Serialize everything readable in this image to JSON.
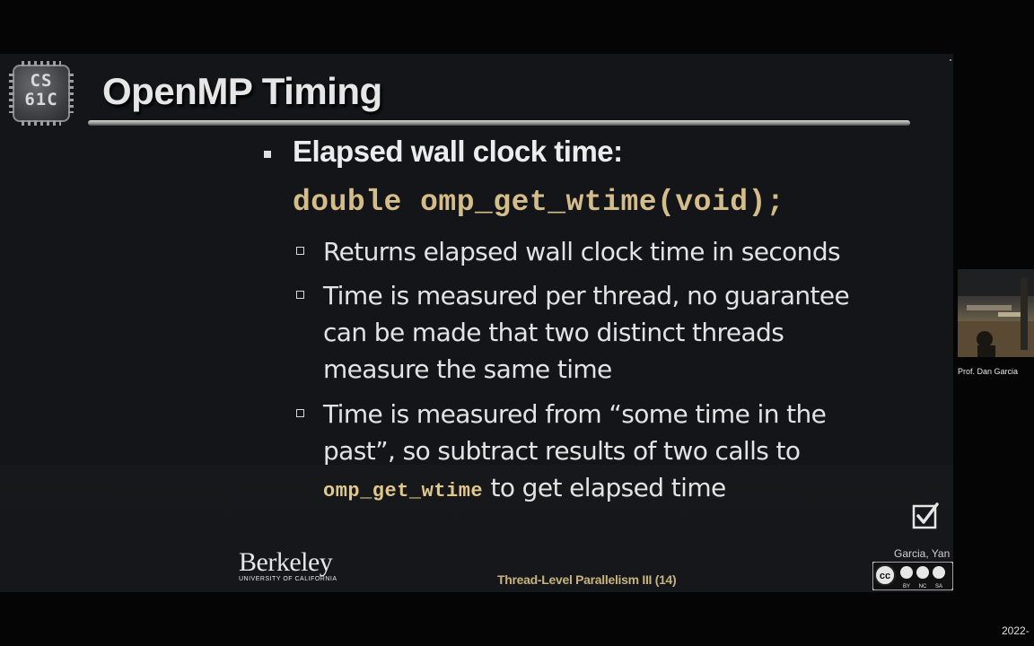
{
  "slide": {
    "logo_text": "CS\n61C",
    "title": "OpenMP Timing",
    "bullet": "Elapsed wall clock time:",
    "code": "double omp_get_wtime(void);",
    "sub_items": [
      "Returns elapsed wall clock time in seconds",
      "Time is measured per thread, no guarantee can be made that two distinct threads measure the same time",
      "Time is measured from “some time in the past”, so subtract results of two calls to"
    ],
    "inline_code": "omp_get_wtime",
    "inline_suffix": " to get elapsed time",
    "footer_title": "Thread-Level Parallelism III (14)",
    "authors": "Garcia, Yan",
    "berkeley_name": "Berkeley",
    "berkeley_sub": "UNIVERSITY OF CALIFORNIA",
    "license_labels": [
      "BY",
      "NC",
      "SA"
    ],
    "checkbox_icon": "checkbox-checked-icon"
  },
  "video": {
    "caption": "Prof. Dan Garcia"
  },
  "timestamp": "2022-"
}
